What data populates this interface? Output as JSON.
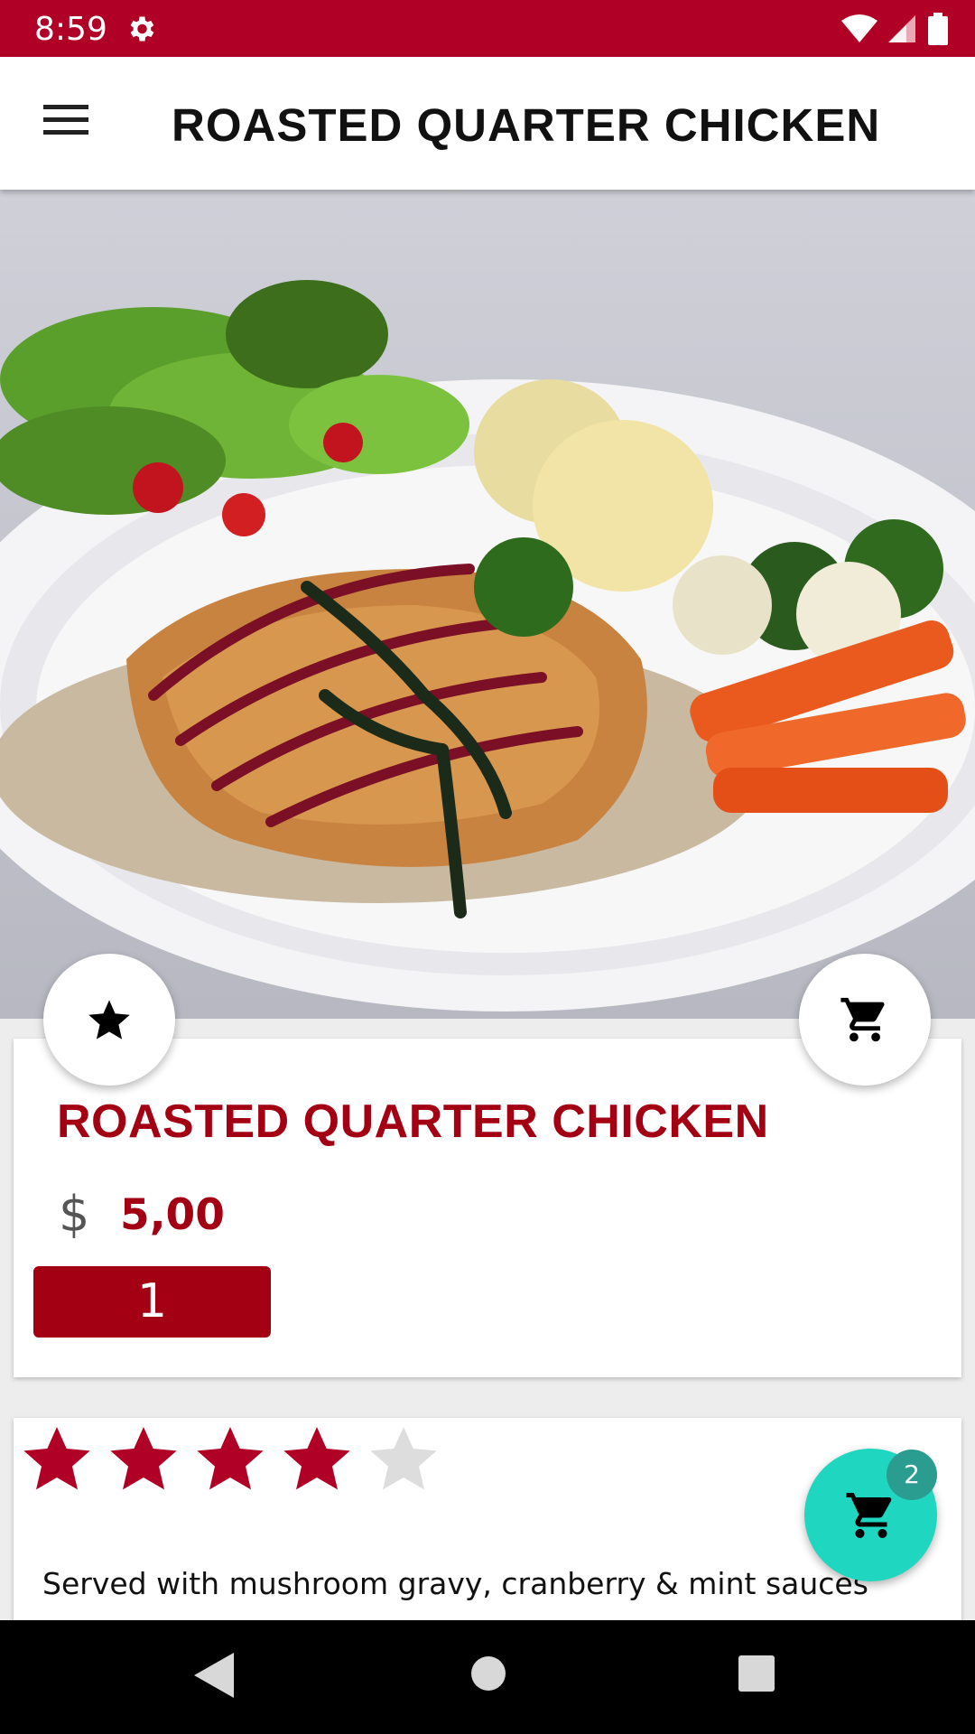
{
  "status_bar": {
    "time": "8:59",
    "icons": [
      "gear-icon",
      "wifi-icon",
      "signal-icon",
      "battery-icon"
    ],
    "background_color": "#b00026"
  },
  "app_bar": {
    "title": "ROASTED QUARTER CHICKEN",
    "menu_icon": "hamburger-icon"
  },
  "hero_image": {
    "subject": "plated roasted chicken with salad, potatoes, broccoli, cauliflower and carrots"
  },
  "actions": {
    "favorite_icon": "star-icon",
    "add_to_cart_icon": "cart-icon"
  },
  "product": {
    "name": "ROASTED QUARTER CHICKEN",
    "currency_symbol": "$",
    "price": "5,00",
    "quantity": "1",
    "accent_color": "#a30013"
  },
  "rating": {
    "value": 4,
    "max": 5,
    "filled_color": "#b00026",
    "empty_color": "#dddddd"
  },
  "description": "Served with mushroom gravy, cranberry & mint sauces",
  "cart": {
    "count": "2",
    "fab_color": "#1fd6c1"
  },
  "nav_bar": {
    "buttons": [
      "back-icon",
      "home-icon",
      "recents-icon"
    ]
  }
}
